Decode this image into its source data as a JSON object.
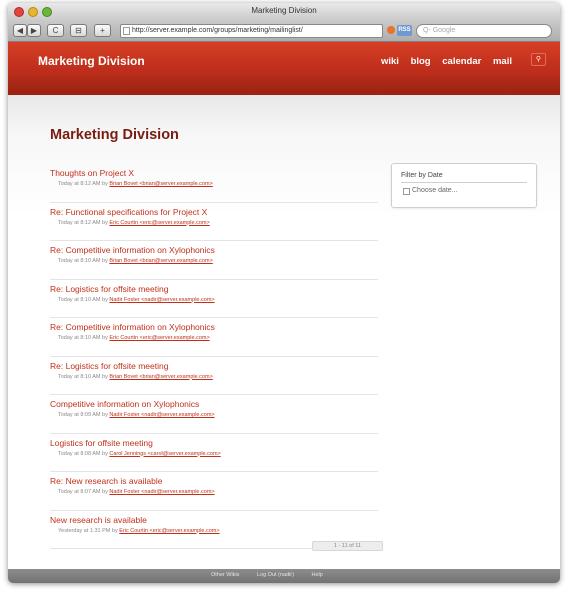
{
  "window": {
    "title": "Marketing Division"
  },
  "toolbar": {
    "back": "◀",
    "forward": "▶",
    "reload": "C",
    "bookmark": "⊟",
    "add": "+",
    "url": "http://server.example.com/groups/marketing/mailinglist/",
    "rss": "RSS",
    "search_placeholder": "Q- Google"
  },
  "header": {
    "brand": "Marketing Division",
    "nav": [
      "wiki",
      "blog",
      "calendar",
      "mail"
    ],
    "search_icon": "search-icon"
  },
  "page": {
    "title": "Marketing Division"
  },
  "messages": [
    {
      "title": "Thoughts on Project X",
      "date": "Today at 8:12 AM",
      "by": "by",
      "author": "Brian Bovet <brian@server.example.com>"
    },
    {
      "title": "Re: Functional specifications for Project X",
      "date": "Today at 8:12 AM",
      "by": "by",
      "author": "Eric Courtin <eric@server.example.com>"
    },
    {
      "title": "Re: Competitive information on Xylophonics",
      "date": "Today at 8:10 AM",
      "by": "by",
      "author": "Brian Bovet <brian@server.example.com>"
    },
    {
      "title": "Re: Logistics for offsite meeting",
      "date": "Today at 8:10 AM",
      "by": "by",
      "author": "Nadir Foster <nadir@server.example.com>"
    },
    {
      "title": "Re: Competitive information on Xylophonics",
      "date": "Today at 8:10 AM",
      "by": "by",
      "author": "Eric Courtin <eric@server.example.com>"
    },
    {
      "title": "Re: Logistics for offsite meeting",
      "date": "Today at 8:10 AM",
      "by": "by",
      "author": "Brian Bovet <brian@server.example.com>"
    },
    {
      "title": "Competitive information on Xylophonics",
      "date": "Today at 8:09 AM",
      "by": "by",
      "author": "Nadir Foster <nadir@server.example.com>"
    },
    {
      "title": "Logistics for offsite meeting",
      "date": "Today at 8:08 AM",
      "by": "by",
      "author": "Carol Jennings <carol@server.example.com>"
    },
    {
      "title": "Re: New research is available",
      "date": "Today at 8:07 AM",
      "by": "by",
      "author": "Nadir Foster <nadir@server.example.com>"
    },
    {
      "title": "New research is available",
      "date": "Yesterday at 1:31 PM",
      "by": "by",
      "author": "Eric Courtin <eric@server.example.com>"
    }
  ],
  "pager": {
    "label": "1 - 11 of 11"
  },
  "filter": {
    "title": "Filter by Date",
    "choose": "Choose date..."
  },
  "footer": {
    "links": [
      "Other Wikis",
      "Log Out (nadir)",
      "Help"
    ]
  },
  "colors": {
    "accent": "#c0301a",
    "header": "#c8341d",
    "title": "#7a1d10"
  }
}
